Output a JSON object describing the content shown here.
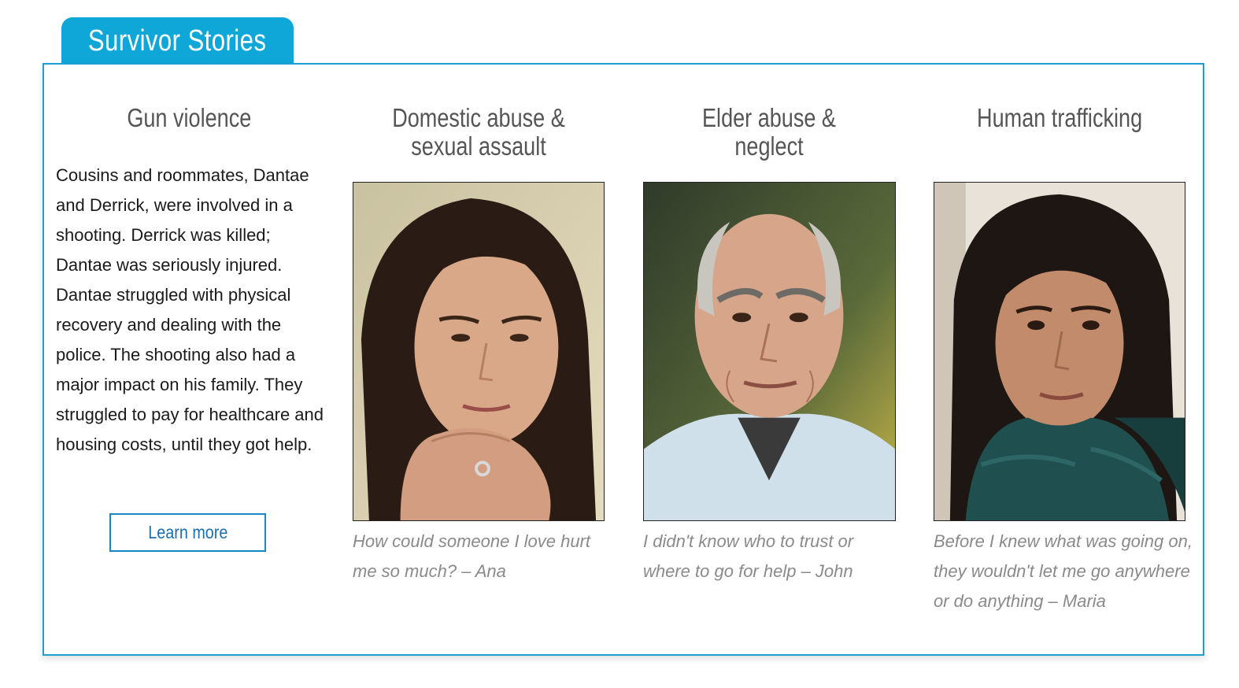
{
  "section": {
    "tab_label": "Survivor Stories"
  },
  "columns": [
    {
      "title": "Gun violence",
      "story": "Cousins and roommates, Dantae and Derrick, were involved in a shooting. Derrick was killed; Dantae was seriously injured. Dantae struggled with physical recovery and dealing with the police. The shooting also had a major impact on his family. They struggled to pay for healthcare and housing costs, until they got help.",
      "button_label": "Learn more"
    },
    {
      "title": "Domestic abuse & sexual assault",
      "quote": "How could someone I love hurt me so much? – Ana"
    },
    {
      "title": "Elder abuse & neglect",
      "quote": "I didn't know who to trust or where to go for help – John"
    },
    {
      "title": "Human trafficking",
      "quote": "Before I knew what was going on, they wouldn't let me go anywhere or do anything – Maria"
    }
  ],
  "colors": {
    "accent": "#0fa6d8",
    "border": "#1a9fd2",
    "button": "#1a86c2"
  }
}
